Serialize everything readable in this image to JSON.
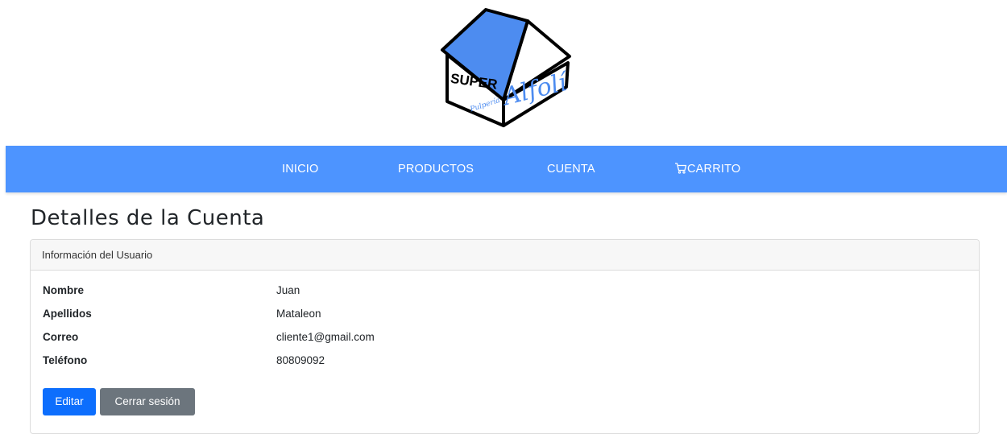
{
  "logo": {
    "word_super": "SUPER",
    "word_alfoli": "Alfolí",
    "word_pulperia": "Pulpería",
    "roof_color": "#4d8cf0"
  },
  "nav": {
    "background": "#4d94ff",
    "items": [
      {
        "label": "INICIO"
      },
      {
        "label": "PRODUCTOS"
      },
      {
        "label": "CUENTA"
      },
      {
        "label": "CARRITO",
        "icon": "cart-icon"
      }
    ]
  },
  "page": {
    "title": "Detalles de la Cuenta"
  },
  "card": {
    "header": "Información del Usuario",
    "fields": [
      {
        "label": "Nombre",
        "value": "Juan"
      },
      {
        "label": "Apellidos",
        "value": "Mataleon"
      },
      {
        "label": "Correo",
        "value": "cliente1@gmail.com"
      },
      {
        "label": "Teléfono",
        "value": "80809092"
      }
    ],
    "edit_button": "Editar",
    "logout_button": "Cerrar sesión"
  }
}
